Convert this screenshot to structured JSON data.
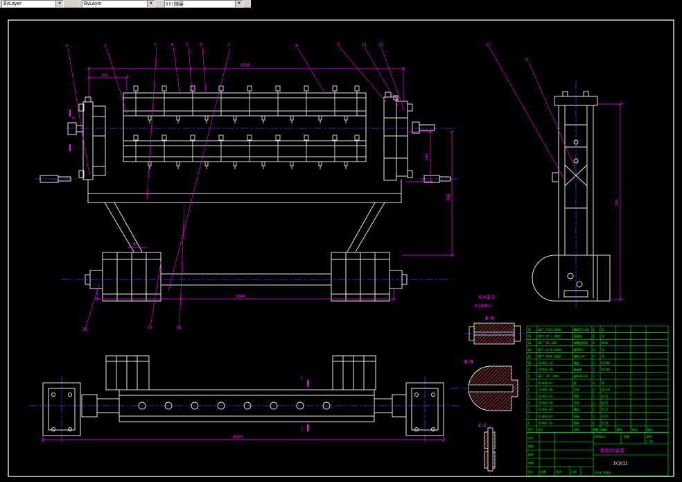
{
  "toolbar": {
    "linetype": "ByLayer",
    "lineweight": "ByLayer",
    "color": "随层"
  },
  "colors": {
    "geometry": "#e8e8e8",
    "dimension": "#ff00ff",
    "centerline": "#3344ff",
    "table": "#00ff00",
    "hatch": "#c03434",
    "toolbar_bg": "#d6d3ce"
  },
  "balloons": {
    "top": [
      "2",
      "2",
      "1",
      "4",
      "5",
      "6",
      "8",
      "3",
      "11",
      "21"
    ],
    "long": "1",
    "side": [
      "12",
      "9"
    ],
    "bottom": [
      "18",
      "15",
      "16"
    ]
  },
  "markers": {
    "section_a": "A",
    "dim_b": "B",
    "cut_c_top": "C",
    "cut_c_bottom": "C"
  },
  "dims": {
    "front_top": "1850",
    "front_top_left": "184",
    "front_right_inner": "390",
    "front_right_outer": "965",
    "front_bottom": "1846",
    "bottom_view": "8550",
    "side_height": "790"
  },
  "sections": {
    "aa": "A-A",
    "bb": "B-B",
    "cc": "C-C"
  },
  "note": {
    "line1": "技术要求",
    "line2": "未注倒角C2"
  },
  "bom": {
    "header": [
      "序号",
      "代号",
      "名称",
      "数量",
      "材料",
      "单件",
      "总计",
      "备注"
    ],
    "rows": [
      [
        "15",
        "GB/T 5783-2000",
        "螺栓M12×40",
        "8",
        "A3",
        "",
        "",
        ""
      ],
      [
        "14",
        "GB/T 97.1-2002",
        "垫圈12",
        "8",
        "A3",
        "",
        "",
        ""
      ],
      [
        "13",
        "GB/T 93-1987",
        "弹簧垫圈12",
        "8",
        "65Mn",
        "",
        "",
        ""
      ],
      [
        "12",
        "GB/T 6170-2000",
        "螺母M12",
        "8",
        "A3",
        "",
        "",
        ""
      ],
      [
        "11",
        "GB/T 1096-2003",
        "键16×63",
        "2",
        "45",
        "",
        "",
        ""
      ],
      [
        "10",
        "JXJ012-10",
        "端盖",
        "2",
        "HT200",
        "",
        "",
        ""
      ],
      [
        "9",
        "JXJ012-09",
        "轴承座",
        "2",
        "HT200",
        "",
        "",
        ""
      ],
      [
        "8",
        "GB/T 297-1994",
        "轴承30310",
        "2",
        "",
        "",
        "",
        ""
      ],
      [
        "7",
        "JXJ012-07",
        "轴",
        "1",
        "45",
        "",
        "",
        ""
      ],
      [
        "6",
        "JXJ012-06",
        "车轮",
        "2",
        "ZG310",
        "",
        "",
        ""
      ],
      [
        "5",
        "JXJ012-05",
        "隔套",
        "2",
        "Q235",
        "",
        "",
        ""
      ],
      [
        "4",
        "JXJ012-04",
        "支架",
        "2",
        "Q235",
        "",
        "",
        ""
      ],
      [
        "3",
        "JXJ012-03",
        "横梁",
        "1",
        "Q235",
        "",
        "",
        ""
      ],
      [
        "2",
        "JXJ012-02",
        "侧板",
        "2",
        "Q235",
        "",
        "",
        ""
      ],
      [
        "1",
        "JXJ012-01",
        "底座",
        "1",
        "Q235",
        "",
        "",
        ""
      ]
    ]
  },
  "titleblock": {
    "title": "制动轮装置",
    "drawing_no": "JXJ012",
    "scale": "1:10",
    "sheet": "共1张 第1张",
    "left_rows": [
      "设计",
      "制图",
      "校核",
      "审核"
    ],
    "bottom_row": [
      "标记",
      "处数",
      "签字",
      "日期"
    ],
    "right_labels": [
      "阶段标记",
      "质量",
      "比例"
    ]
  }
}
